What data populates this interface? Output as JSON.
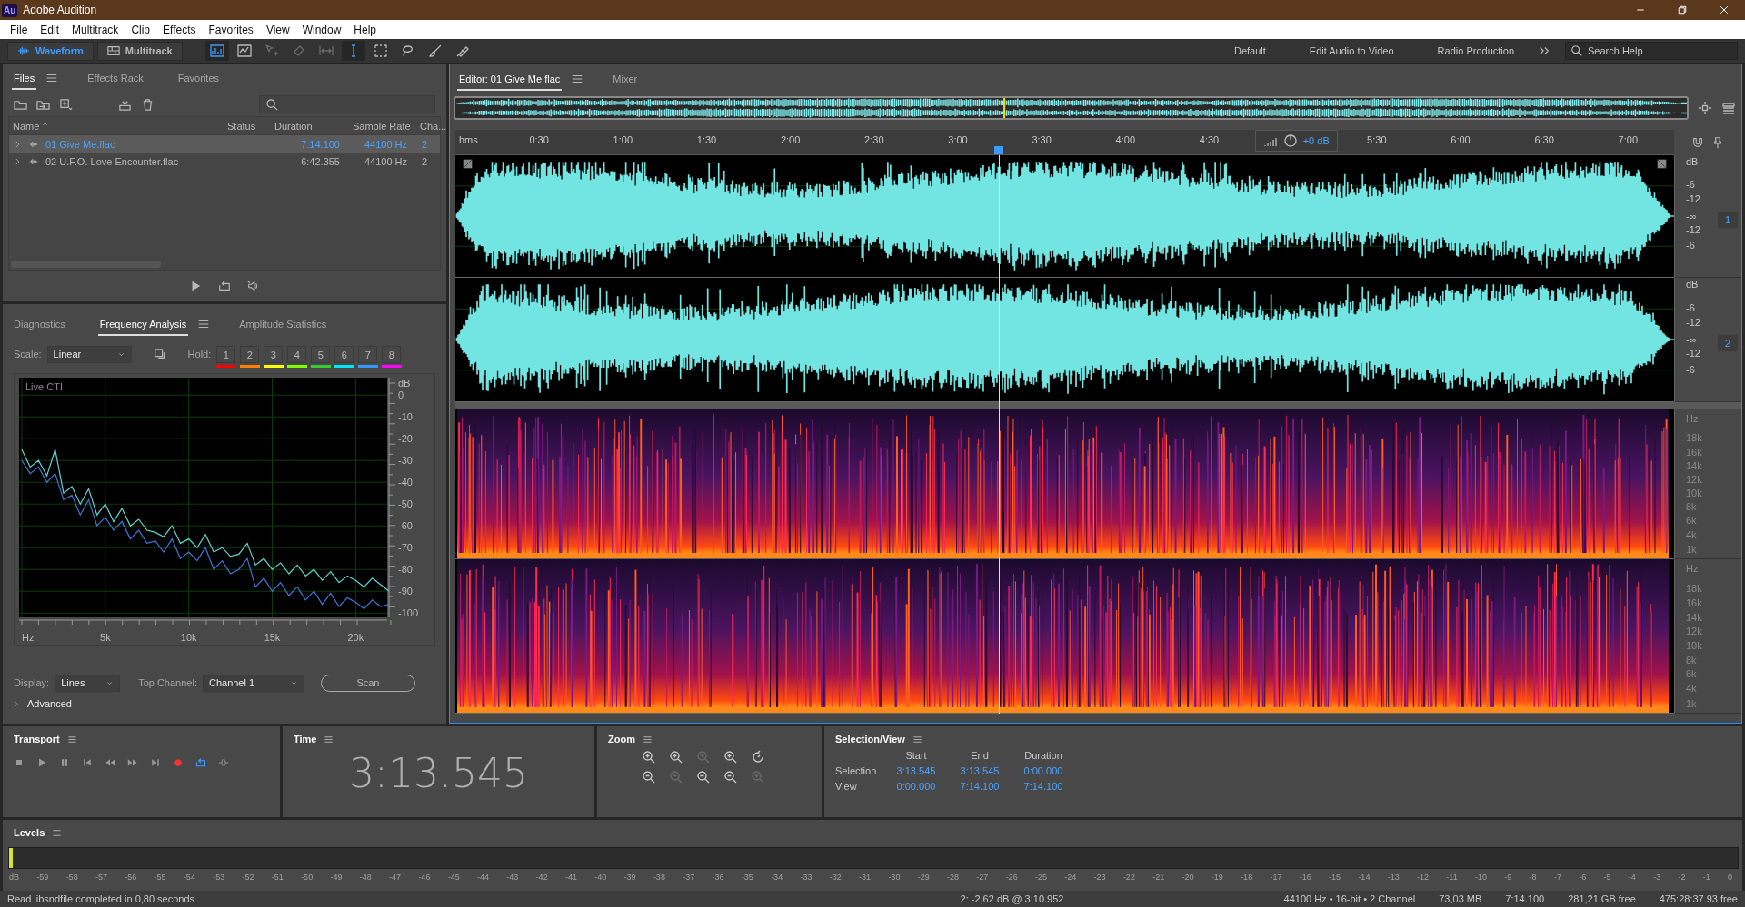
{
  "window": {
    "logo": "Au",
    "title": "Adobe Audition"
  },
  "menu": [
    "File",
    "Edit",
    "Multitrack",
    "Clip",
    "Effects",
    "Favorites",
    "View",
    "Window",
    "Help"
  ],
  "toolbar": {
    "modes": [
      {
        "label": "Waveform",
        "kind": "waveform",
        "selected": true
      },
      {
        "label": "Multitrack",
        "kind": "multitrack",
        "selected": false
      }
    ],
    "tools": [
      {
        "kind": "spectral",
        "selected": true,
        "disabled": false
      },
      {
        "kind": "pitch",
        "selected": false,
        "disabled": false
      },
      {
        "kind": "move",
        "selected": false,
        "disabled": true
      },
      {
        "kind": "razor",
        "selected": false,
        "disabled": true
      },
      {
        "kind": "slip",
        "selected": false,
        "disabled": true
      },
      {
        "kind": "ibeam",
        "selected": true,
        "disabled": false
      },
      {
        "kind": "marquee",
        "selected": false,
        "disabled": false
      },
      {
        "kind": "lasso",
        "selected": false,
        "disabled": false
      },
      {
        "kind": "brush",
        "selected": false,
        "disabled": false
      },
      {
        "kind": "healing",
        "selected": false,
        "disabled": false
      }
    ],
    "workspaces": [
      "Default",
      "Edit Audio to Video",
      "Radio Production"
    ],
    "search_placeholder": "Search Help"
  },
  "files": {
    "tabs": [
      {
        "label": "Files",
        "selected": true
      },
      {
        "label": "Effects Rack",
        "selected": false
      },
      {
        "label": "Favorites",
        "selected": false
      }
    ],
    "columns": [
      "Name",
      "Status",
      "Duration",
      "Sample Rate",
      "Cha..."
    ],
    "rows": [
      {
        "name": "01 Give Me.flac",
        "duration": "7:14.100",
        "sample_rate": "44100 Hz",
        "channels": "2",
        "selected": true
      },
      {
        "name": "02 U.F.O. Love Encounter.flac",
        "duration": "6:42.355",
        "sample_rate": "44100 Hz",
        "channels": "2",
        "selected": false
      }
    ]
  },
  "analysis": {
    "tabs": [
      {
        "label": "Diagnostics",
        "selected": false
      },
      {
        "label": "Frequency Analysis",
        "selected": true
      },
      {
        "label": "Amplitude Statistics",
        "selected": false
      }
    ],
    "scale_label": "Scale:",
    "scale": "Linear",
    "hold_label": "Hold:",
    "holds": [
      {
        "label": "1",
        "color": "#ff0000"
      },
      {
        "label": "2",
        "color": "#ff8000"
      },
      {
        "label": "3",
        "color": "#ffff00"
      },
      {
        "label": "4",
        "color": "#80ff00"
      },
      {
        "label": "5",
        "color": "#33cc33"
      },
      {
        "label": "6",
        "color": "#00e5ff"
      },
      {
        "label": "7",
        "color": "#3399ff"
      },
      {
        "label": "8",
        "color": "#ff00ff"
      }
    ],
    "chart_label": "Live CTI",
    "chart_data": {
      "type": "line",
      "grid": true,
      "ylabel": "dB",
      "xlim": [
        0,
        22050
      ],
      "ylim": [
        -102,
        8
      ],
      "xticks": [
        {
          "value": 0,
          "label": "Hz"
        },
        {
          "value": 5000,
          "label": "5k"
        },
        {
          "value": 10000,
          "label": "10k"
        },
        {
          "value": 15000,
          "label": "15k"
        },
        {
          "value": 20000,
          "label": "20k"
        }
      ],
      "yticks": [
        0,
        -10,
        -20,
        -30,
        -40,
        -50,
        -60,
        -70,
        -80,
        -90,
        -100
      ],
      "x": [
        0,
        500,
        1000,
        1500,
        2000,
        2500,
        3000,
        3500,
        4000,
        4500,
        5000,
        5500,
        6000,
        6500,
        7000,
        7500,
        8000,
        8500,
        9000,
        9500,
        10000,
        10500,
        11000,
        11500,
        12000,
        12500,
        13000,
        13500,
        14000,
        14500,
        15000,
        15500,
        16000,
        16500,
        17000,
        17500,
        18000,
        18500,
        19000,
        19500,
        20000,
        20500,
        21000,
        21500,
        22000
      ],
      "series": [
        {
          "color": "#5fd6d0",
          "values": [
            -25,
            -33,
            -30,
            -37,
            -25,
            -45,
            -42,
            -50,
            -43,
            -55,
            -50,
            -58,
            -52,
            -60,
            -57,
            -62,
            -63,
            -65,
            -60,
            -68,
            -66,
            -70,
            -64,
            -72,
            -70,
            -74,
            -73,
            -68,
            -78,
            -75,
            -80,
            -77,
            -82,
            -78,
            -83,
            -80,
            -85,
            -81,
            -86,
            -83,
            -85,
            -88,
            -84,
            -87,
            -90
          ]
        },
        {
          "color": "#3f78d6",
          "values": [
            -30,
            -36,
            -33,
            -40,
            -36,
            -48,
            -46,
            -55,
            -48,
            -60,
            -56,
            -62,
            -58,
            -66,
            -62,
            -68,
            -67,
            -72,
            -66,
            -75,
            -72,
            -76,
            -70,
            -80,
            -76,
            -82,
            -80,
            -75,
            -88,
            -84,
            -90,
            -86,
            -92,
            -88,
            -94,
            -90,
            -96,
            -91,
            -97,
            -93,
            -95,
            -98,
            -94,
            -97,
            -96
          ]
        }
      ]
    },
    "display_label": "Display:",
    "display": "Lines",
    "top_channel_label": "Top Channel:",
    "top_channel": "Channel 1",
    "scan": "Scan",
    "advanced": {
      "label": "Advanced",
      "expanded": false
    }
  },
  "editor": {
    "tabs": [
      {
        "label": "Editor: 01 Give Me.flac",
        "selected": true
      },
      {
        "label": "Mixer",
        "selected": false
      }
    ],
    "ruler": {
      "unit": "hms",
      "ticks": [
        "0:30",
        "1:00",
        "1:30",
        "2:00",
        "2:30",
        "3:00",
        "3:30",
        "4:00",
        "4:30",
        "5:30",
        "6:00",
        "6:30",
        "7:00"
      ]
    },
    "gain": "+0 dB",
    "playhead": {
      "level": 0.4458
    },
    "waveform_channels": [
      {
        "label": "1",
        "scale": [
          "dB",
          "-6",
          "-12",
          "-∞",
          "-12",
          "-6"
        ]
      },
      {
        "label": "2",
        "scale": [
          "dB",
          "-6",
          "-12",
          "-∞",
          "-12",
          "-6"
        ]
      }
    ],
    "spectral_channels": [
      {
        "scale": [
          "Hz",
          "18k",
          "16k",
          "14k",
          "12k",
          "10k",
          "8k",
          "6k",
          "4k",
          "1k"
        ]
      },
      {
        "scale": [
          "Hz",
          "18k",
          "16k",
          "14k",
          "12k",
          "10k",
          "8k",
          "6k",
          "4k",
          "1k"
        ]
      }
    ]
  },
  "transport": {
    "title": "Transport",
    "loop": true
  },
  "time": {
    "title": "Time",
    "value": "3:13.545"
  },
  "zoom": {
    "title": "Zoom",
    "buttons": [
      {
        "kind": "in",
        "disabled": false
      },
      {
        "kind": "in",
        "disabled": false
      },
      {
        "kind": "in",
        "disabled": true
      },
      {
        "kind": "in",
        "disabled": false
      },
      {
        "kind": "reset",
        "disabled": false
      },
      {
        "kind": "out",
        "disabled": false
      },
      {
        "kind": "out",
        "disabled": true
      },
      {
        "kind": "out",
        "disabled": false
      },
      {
        "kind": "out",
        "disabled": false
      },
      {
        "kind": "in",
        "disabled": true
      }
    ]
  },
  "selection_view": {
    "title": "Selection/View",
    "columns": [
      "Start",
      "End",
      "Duration"
    ],
    "rows": [
      {
        "label": "Selection",
        "values": [
          "3:13.545",
          "3:13.545",
          "0:00.000"
        ]
      },
      {
        "label": "View",
        "values": [
          "0:00.000",
          "7:14.100",
          "7:14.100"
        ]
      }
    ]
  },
  "levels": {
    "title": "Levels",
    "level": 0.002,
    "scale": [
      "dB",
      "-59",
      "-58",
      "-57",
      "-56",
      "-55",
      "-54",
      "-53",
      "-52",
      "-51",
      "-50",
      "-49",
      "-48",
      "-47",
      "-46",
      "-45",
      "-44",
      "-43",
      "-42",
      "-41",
      "-40",
      "-39",
      "-38",
      "-37",
      "-36",
      "-35",
      "-34",
      "-33",
      "-32",
      "-31",
      "-30",
      "-29",
      "-28",
      "-27",
      "-26",
      "-25",
      "-24",
      "-23",
      "-22",
      "-21",
      "-20",
      "-19",
      "-18",
      "-17",
      "-16",
      "-15",
      "-14",
      "-13",
      "-12",
      "-11",
      "-10",
      "-9",
      "-8",
      "-7",
      "-6",
      "-5",
      "-4",
      "-3",
      "-2",
      "-1",
      "0"
    ]
  },
  "status": {
    "message": "Read libsndfile completed in 0,80 seconds",
    "cursor": "2: -2,62 dB @ 3:10.952",
    "format": "44100 Hz • 16-bit • 2 Channel",
    "size": "73,03 MB",
    "duration": "7:14.100",
    "disk_free": "281,21 GB free",
    "time_free": "475:28:37.93 free"
  }
}
